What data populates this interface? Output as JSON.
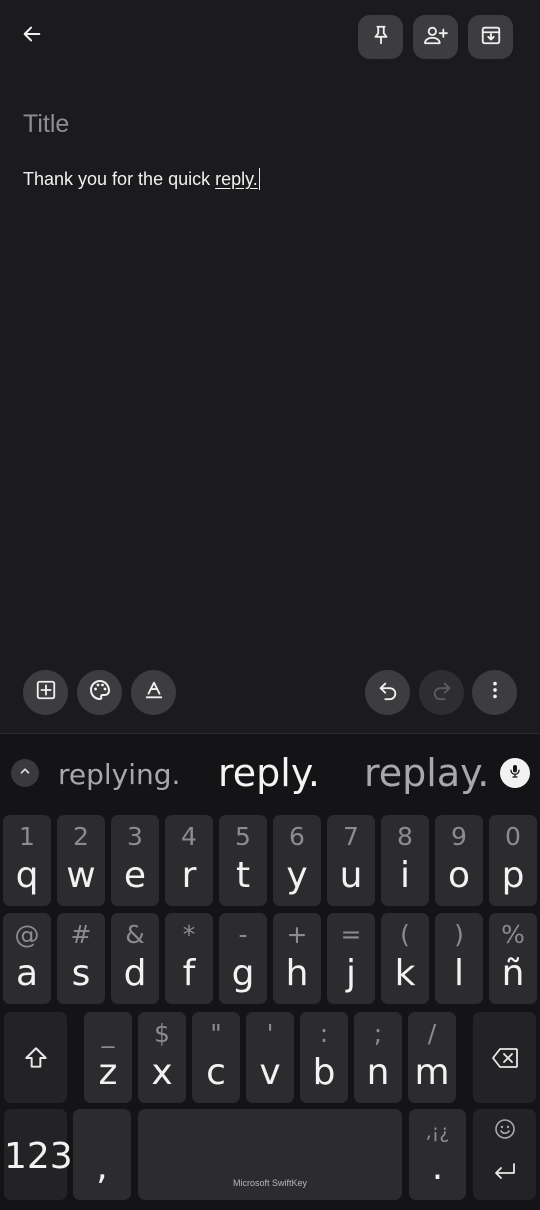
{
  "note": {
    "title_placeholder": "Title",
    "body_text": "Thank you for the quick ",
    "current_word": "reply."
  },
  "top_bar": {
    "icons": [
      "back-arrow-icon",
      "pin-icon",
      "add-collaborator-icon",
      "archive-icon"
    ]
  },
  "editor_toolbar": {
    "icons": [
      "add-box-icon",
      "palette-icon",
      "text-format-icon",
      "undo-icon",
      "redo-icon",
      "more-vert-icon"
    ]
  },
  "keyboard": {
    "suggestions": [
      "replying.",
      "reply.",
      "replay."
    ],
    "row1": [
      {
        "hint": "1",
        "key": "q"
      },
      {
        "hint": "2",
        "key": "w"
      },
      {
        "hint": "3",
        "key": "e"
      },
      {
        "hint": "4",
        "key": "r"
      },
      {
        "hint": "5",
        "key": "t"
      },
      {
        "hint": "6",
        "key": "y"
      },
      {
        "hint": "7",
        "key": "u"
      },
      {
        "hint": "8",
        "key": "i"
      },
      {
        "hint": "9",
        "key": "o"
      },
      {
        "hint": "0",
        "key": "p"
      }
    ],
    "row2": [
      {
        "hint": "@",
        "key": "a"
      },
      {
        "hint": "#",
        "key": "s"
      },
      {
        "hint": "&",
        "key": "d"
      },
      {
        "hint": "*",
        "key": "f"
      },
      {
        "hint": "-",
        "key": "g"
      },
      {
        "hint": "+",
        "key": "h"
      },
      {
        "hint": "=",
        "key": "j"
      },
      {
        "hint": "(",
        "key": "k"
      },
      {
        "hint": ")",
        "key": "l"
      },
      {
        "hint": "%",
        "key": "ñ"
      }
    ],
    "row3": [
      {
        "hint": "_",
        "key": "z"
      },
      {
        "hint": "$",
        "key": "x"
      },
      {
        "hint": "\"",
        "key": "c"
      },
      {
        "hint": "'",
        "key": "v"
      },
      {
        "hint": ":",
        "key": "b"
      },
      {
        "hint": ";",
        "key": "n"
      },
      {
        "hint": "/",
        "key": "m"
      }
    ],
    "numbers_label": "123",
    "comma_key": ",",
    "space_brand": "Microsoft SwiftKey",
    "period_hint": ",¡¿",
    "period_key": ".",
    "icons": [
      "shift-icon",
      "backspace-icon",
      "emoji-icon",
      "enter-icon",
      "expand-icon",
      "mic-icon"
    ]
  }
}
